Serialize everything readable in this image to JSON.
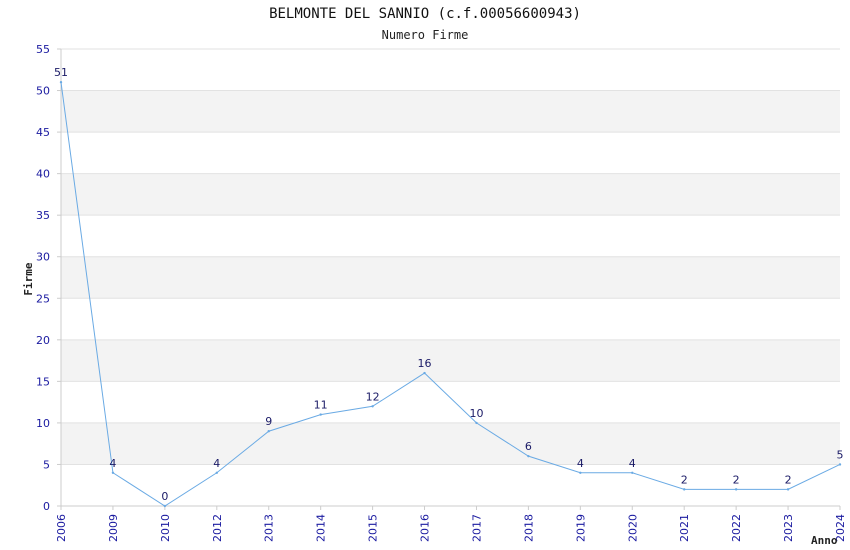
{
  "chart_data": {
    "type": "line",
    "title": "BELMONTE DEL SANNIO (c.f.00056600943)",
    "subtitle": "Numero Firme",
    "xlabel": "Anno",
    "ylabel": "Firme",
    "categories": [
      "2006",
      "2009",
      "2010",
      "2012",
      "2013",
      "2014",
      "2015",
      "2016",
      "2017",
      "2018",
      "2019",
      "2020",
      "2021",
      "2022",
      "2023",
      "2024"
    ],
    "values": [
      51,
      4,
      0,
      4,
      9,
      11,
      12,
      16,
      10,
      6,
      4,
      4,
      2,
      2,
      2,
      5
    ],
    "ylim": [
      0,
      55
    ],
    "yticks": [
      0,
      5,
      10,
      15,
      20,
      25,
      30,
      35,
      40,
      45,
      50,
      55
    ],
    "grid": true,
    "colors": {
      "line": "#6aaae4",
      "band": "#f3f3f3",
      "tick_label": "#1a1aa0",
      "data_label": "#1a1a66",
      "axis": "#cccccc"
    }
  }
}
